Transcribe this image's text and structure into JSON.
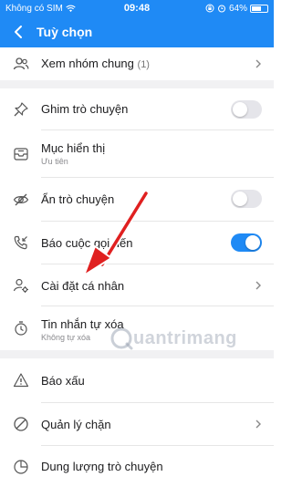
{
  "status_bar": {
    "carrier": "Không có SIM",
    "time": "09:48",
    "battery": "64%",
    "battery_level": 0.64
  },
  "header": {
    "title": "Tuỳ chọn"
  },
  "rows": {
    "shared_groups": {
      "label": "Xem nhóm chung",
      "count": "(1)"
    },
    "pin_chat": {
      "label": "Ghim trò chuyện",
      "toggle": false
    },
    "display_section": {
      "label": "Mục hiển thị",
      "sub": "Ưu tiên"
    },
    "hide_chat": {
      "label": "Ẩn trò chuyện",
      "toggle": false
    },
    "call_alert": {
      "label": "Báo cuộc gọi đến",
      "toggle": true
    },
    "personal_settings": {
      "label": "Cài đặt cá nhân"
    },
    "disappearing_messages": {
      "label": "Tin nhắn tự xóa",
      "sub": "Không tự xóa"
    },
    "report": {
      "label": "Báo xấu"
    },
    "block_manager": {
      "label": "Quản lý chặn"
    },
    "storage": {
      "label": "Dung lượng trò chuyện"
    }
  },
  "watermark": {
    "text": "uantrimang"
  },
  "colors": {
    "accent": "#1f8af5",
    "arrow": "#e02020"
  }
}
